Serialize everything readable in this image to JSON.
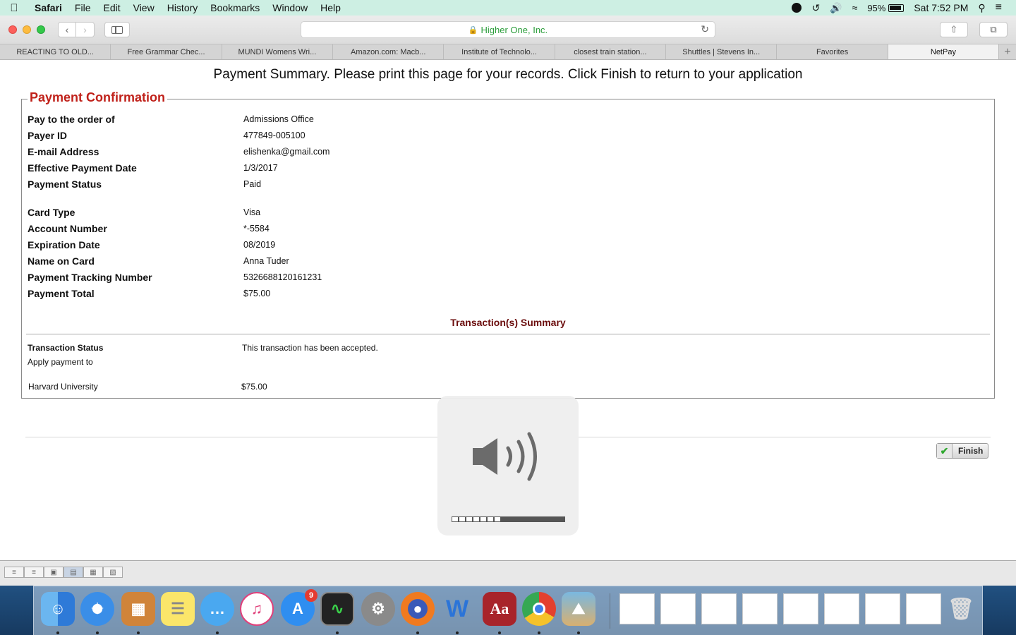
{
  "menubar": {
    "app_name": "Safari",
    "items": [
      "File",
      "Edit",
      "View",
      "History",
      "Bookmarks",
      "Window",
      "Help"
    ],
    "battery": "95%",
    "clock": "Sat 7:52 PM"
  },
  "browser": {
    "address": "Higher One, Inc.",
    "tabs": [
      "REACTING TO OLD...",
      "Free Grammar Chec...",
      "MUNDI Womens Wri...",
      "Amazon.com: Macb...",
      "Institute of Technolo...",
      "closest train station...",
      "Shuttles | Stevens In...",
      "Favorites",
      "NetPay"
    ],
    "active_tab": "NetPay"
  },
  "page": {
    "heading": "Payment Summary. Please print this page for your records. Click Finish to return to your application",
    "legend": "Payment Confirmation",
    "fields": [
      {
        "label": "Pay to the order of",
        "value": "Admissions Office"
      },
      {
        "label": "Payer ID",
        "value": "477849-005100"
      },
      {
        "label": "E-mail Address",
        "value": "elishenka@gmail.com"
      },
      {
        "label": "Effective Payment Date",
        "value": "1/3/2017"
      },
      {
        "label": "Payment Status",
        "value": "Paid"
      },
      {
        "label": "Card Type",
        "value": "Visa"
      },
      {
        "label": "Account Number",
        "value": "*-5584"
      },
      {
        "label": "Expiration Date",
        "value": "08/2019"
      },
      {
        "label": "Name on Card",
        "value": "Anna Tuder"
      },
      {
        "label": "Payment Tracking Number",
        "value": "5326688120161231"
      },
      {
        "label": "Payment Total",
        "value": "$75.00"
      }
    ],
    "transactions_title": "Transaction(s) Summary",
    "transaction_status_label": "Transaction Status",
    "transaction_status_value": "This transaction has been accepted.",
    "apply_payment_label": "Apply payment to",
    "payee": "Harvard University",
    "payee_amount": "$75.00",
    "finish_label": "Finish"
  },
  "volume_hud": {
    "level_fraction": 0.4375,
    "filled_segments": 7,
    "total_segments": 16
  },
  "dock": {
    "apps": [
      "finder-icon",
      "safari-icon",
      "calculator-icon",
      "notes-icon",
      "messages-icon",
      "itunes-icon",
      "app-store-icon",
      "activity-monitor-icon",
      "system-preferences-icon",
      "firefox-icon",
      "word-icon",
      "dictionary-icon",
      "chrome-icon",
      "preview-icon"
    ],
    "app_store_badge": "9",
    "dictionary_label": "Aa"
  }
}
